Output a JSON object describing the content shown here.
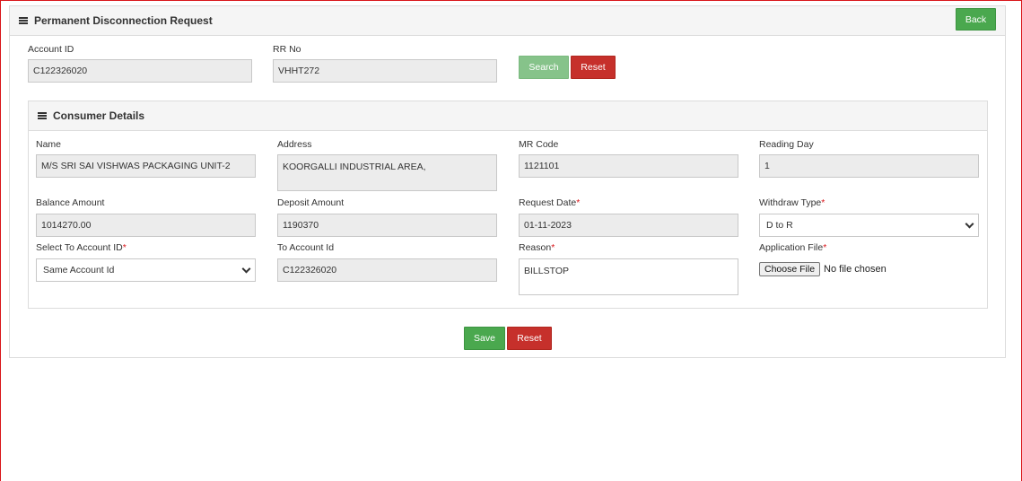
{
  "panel": {
    "title": "Permanent Disconnection Request",
    "back_label": "Back"
  },
  "search": {
    "account_id_label": "Account ID",
    "account_id_value": "C122326020",
    "rr_no_label": "RR No",
    "rr_no_value": "VHHT272",
    "search_label": "Search",
    "reset_label": "Reset"
  },
  "consumer": {
    "title": "Consumer Details",
    "name_label": "Name",
    "name_value": "M/S SRI SAI VISHWAS PACKAGING UNIT-2",
    "address_label": "Address",
    "address_value": "KOORGALLI INDUSTRIAL AREA,",
    "mr_code_label": "MR Code",
    "mr_code_value": "1121101",
    "reading_day_label": "Reading Day",
    "reading_day_value": "1",
    "balance_label": "Balance Amount",
    "balance_value": "1014270.00",
    "deposit_label": "Deposit Amount",
    "deposit_value": "1190370",
    "request_date_label": "Request Date",
    "request_date_value": "01-11-2023",
    "withdraw_type_label": "Withdraw Type",
    "withdraw_type_value": "D to R",
    "select_to_account_label": "Select To Account ID",
    "select_to_account_value": "Same Account Id",
    "to_account_label": "To Account Id",
    "to_account_value": "C122326020",
    "reason_label": "Reason",
    "reason_value": "BILLSTOP",
    "application_file_label": "Application File",
    "choose_file_label": "Choose File",
    "no_file_text": "No file chosen",
    "required_mark": "*"
  },
  "footer": {
    "save_label": "Save",
    "reset_label": "Reset"
  },
  "colors": {
    "green": "#4aa84e",
    "red": "#c6302b",
    "border_red": "#d9161a"
  }
}
